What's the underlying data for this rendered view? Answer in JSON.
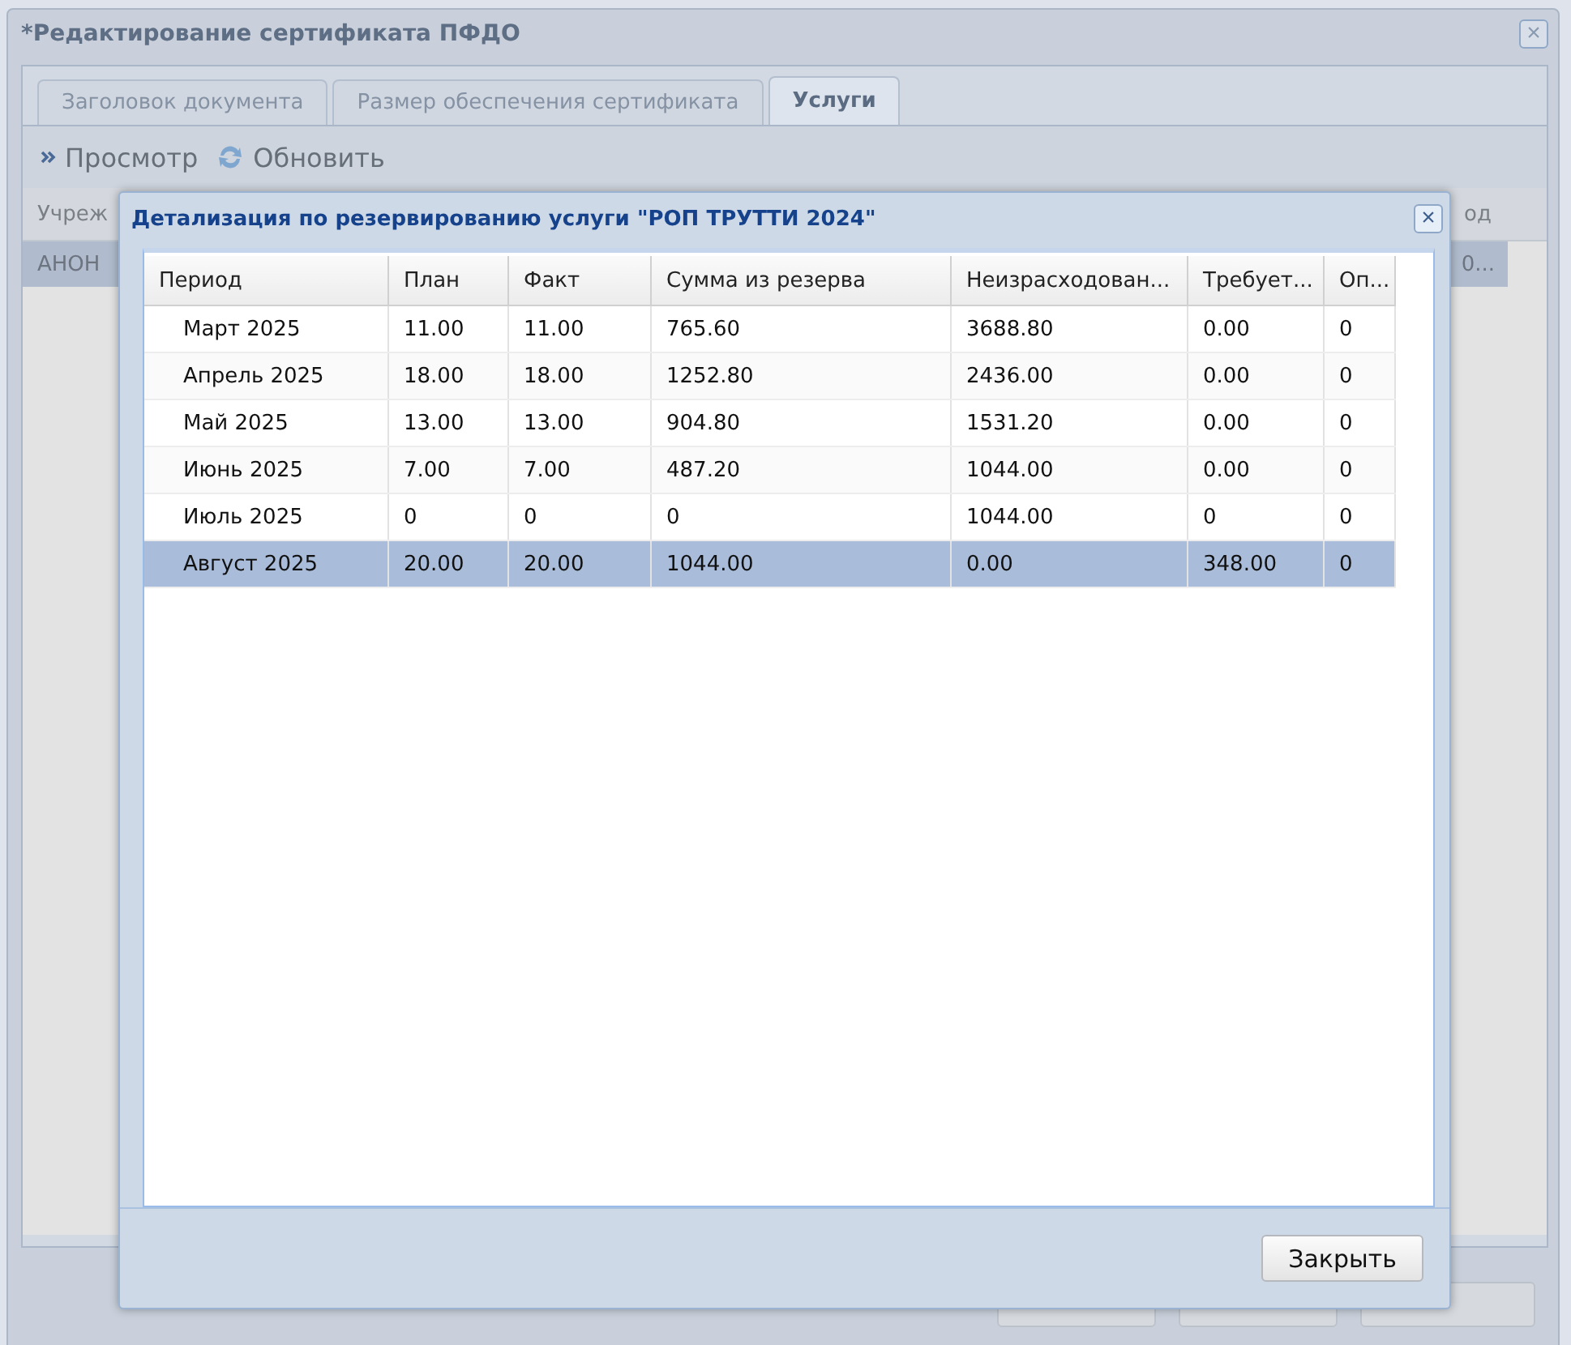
{
  "window": {
    "title": "*Редактирование сертификата ПФДО",
    "close": "×"
  },
  "tabs": [
    {
      "label": "Заголовок документа",
      "selected": false
    },
    {
      "label": "Размер обеспечения сертификата",
      "selected": false
    },
    {
      "label": "Услуги",
      "selected": true
    }
  ],
  "toolbar": [
    {
      "label": "Просмотр",
      "kind": "view"
    },
    {
      "label": "Обновить",
      "kind": "refresh"
    }
  ],
  "grid": {
    "columns": [
      "Учреж",
      "од"
    ],
    "rows": [
      {
        "cells": [
          "АНОН",
          "0..."
        ],
        "selected": true
      }
    ]
  },
  "hidden_buttons": [
    {
      "kind": "button"
    },
    {
      "kind": "button"
    },
    {
      "kind": "button"
    }
  ],
  "dialog": {
    "title": "Детализация по резервированию услуги \"РОП ТРУТТИ 2024\"",
    "close": "×",
    "columns": [
      "Период",
      "План",
      "Факт",
      "Сумма из резерва",
      "Неизрасходован...",
      "Требует...",
      "Оп..."
    ],
    "rows": [
      {
        "cells": [
          "Март 2025",
          "11.00",
          "11.00",
          "765.60",
          "3688.80",
          "0.00",
          "0"
        ],
        "selected": false
      },
      {
        "cells": [
          "Апрель 2025",
          "18.00",
          "18.00",
          "1252.80",
          "2436.00",
          "0.00",
          "0"
        ],
        "selected": false
      },
      {
        "cells": [
          "Май 2025",
          "13.00",
          "13.00",
          "904.80",
          "1531.20",
          "0.00",
          "0"
        ],
        "selected": false
      },
      {
        "cells": [
          "Июнь 2025",
          "7.00",
          "7.00",
          "487.20",
          "1044.00",
          "0.00",
          "0"
        ],
        "selected": false
      },
      {
        "cells": [
          "Июль 2025",
          "0",
          "0",
          "0",
          "1044.00",
          "0",
          "0"
        ],
        "selected": false
      },
      {
        "cells": [
          "Август 2025",
          "20.00",
          "20.00",
          "1044.00",
          "0.00",
          "348.00",
          "0"
        ],
        "selected": true
      }
    ],
    "buttons": [
      "Закрыть"
    ]
  }
}
